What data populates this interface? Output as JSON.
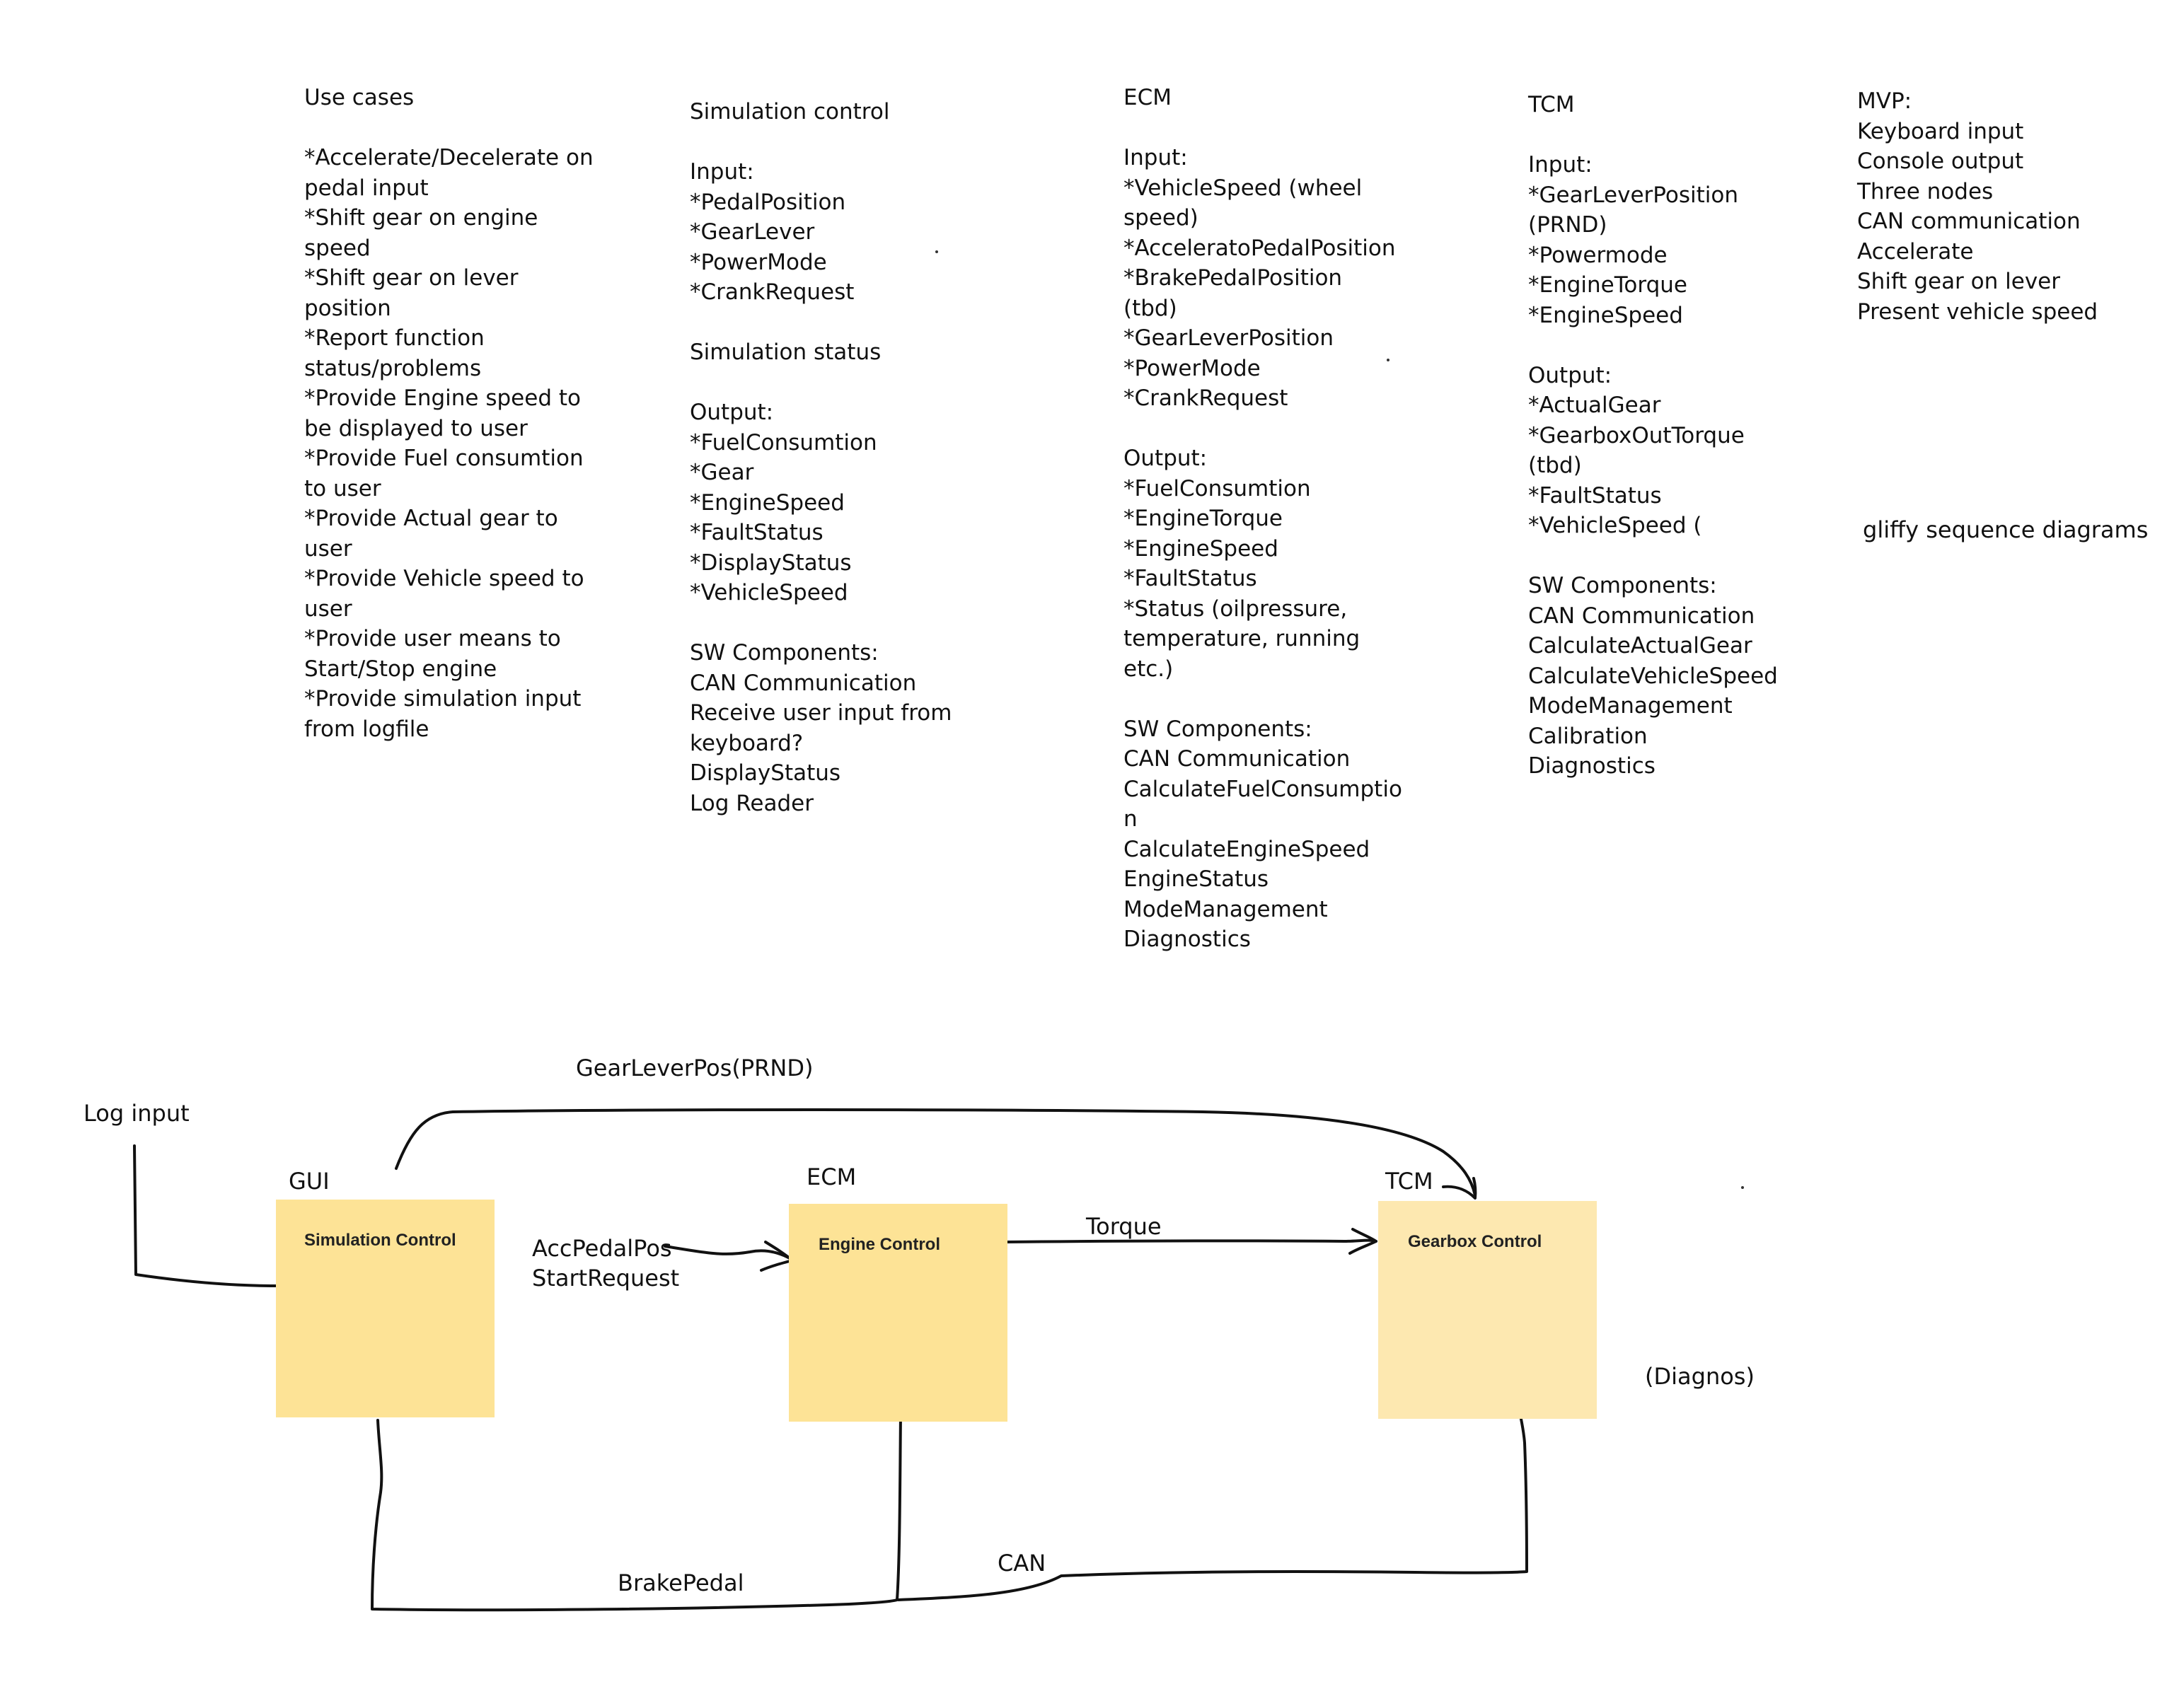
{
  "notes": {
    "use_cases": [
      "Use cases",
      "",
      "*Accelerate/Decelerate on",
      "pedal input",
      "*Shift gear on engine",
      "speed",
      "*Shift gear on lever",
      "position",
      "*Report function",
      "status/problems",
      "*Provide Engine speed to",
      "be displayed to user",
      "*Provide Fuel consumtion",
      "to user",
      "*Provide Actual gear to",
      "user",
      "*Provide Vehicle speed to",
      "user",
      "*Provide user means to",
      "Start/Stop engine",
      "*Provide simulation input",
      "from logfile"
    ],
    "simulation_control": [
      "Simulation control",
      "",
      "Input:",
      "*PedalPosition",
      "*GearLever",
      "*PowerMode",
      "*CrankRequest",
      "",
      "Simulation status",
      "",
      "Output:",
      "*FuelConsumtion",
      "*Gear",
      "*EngineSpeed",
      "*FaultStatus",
      "*DisplayStatus",
      "*VehicleSpeed",
      "",
      "SW Components:",
      "CAN Communication",
      "Receive user input from",
      "keyboard?",
      "DisplayStatus",
      "Log Reader"
    ],
    "ecm": [
      "ECM",
      "",
      "Input:",
      "*VehicleSpeed (wheel",
      "speed)",
      "*AcceleratoPedalPosition",
      "*BrakePedalPosition",
      "(tbd)",
      "*GearLeverPosition",
      "*PowerMode",
      "*CrankRequest",
      "",
      "Output:",
      "*FuelConsumtion",
      "*EngineTorque",
      "*EngineSpeed",
      "*FaultStatus",
      "*Status (oilpressure,",
      "temperature, running",
      "etc.)",
      "",
      "SW Components:",
      "CAN Communication",
      "CalculateFuelConsumptio",
      "n",
      "CalculateEngineSpeed",
      "EngineStatus",
      "ModeManagement",
      "Diagnostics"
    ],
    "tcm": [
      "TCM",
      "",
      "Input:",
      "*GearLeverPosition",
      "(PRND)",
      "*Powermode",
      "*EngineTorque",
      "*EngineSpeed",
      "",
      "Output:",
      "*ActualGear",
      "*GearboxOutTorque",
      "(tbd)",
      "*FaultStatus",
      "*VehicleSpeed (",
      "",
      "SW Components:",
      "CAN Communication",
      "CalculateActualGear",
      "CalculateVehicleSpeed",
      "ModeManagement",
      "Calibration",
      "Diagnostics"
    ],
    "mvp": [
      "MVP:",
      "Keyboard input",
      "Console output",
      "Three nodes",
      "CAN communication",
      "Accelerate",
      "Shift gear on lever",
      "Present vehicle speed"
    ],
    "gliffy": "gliffy sequence diagrams"
  },
  "diagram": {
    "log_input": "Log input",
    "gear_lever_pos": "GearLeverPos(PRND)",
    "acc_pedal_pos": "AccPedalPos",
    "start_request": "StartRequest",
    "torque": "Torque",
    "diagnos": "(Diagnos)",
    "brake_pedal": "BrakePedal",
    "can": "CAN",
    "nodes": {
      "gui": {
        "tag": "GUI",
        "title": "Simulation Control"
      },
      "ecm": {
        "tag": "ECM",
        "title": "Engine Control"
      },
      "tcm": {
        "tag": "TCM",
        "title": "Gearbox Control"
      }
    }
  },
  "colors": {
    "box_fill": "#fde396",
    "box_fill_light": "#fde8b0",
    "ink": "#111111"
  }
}
